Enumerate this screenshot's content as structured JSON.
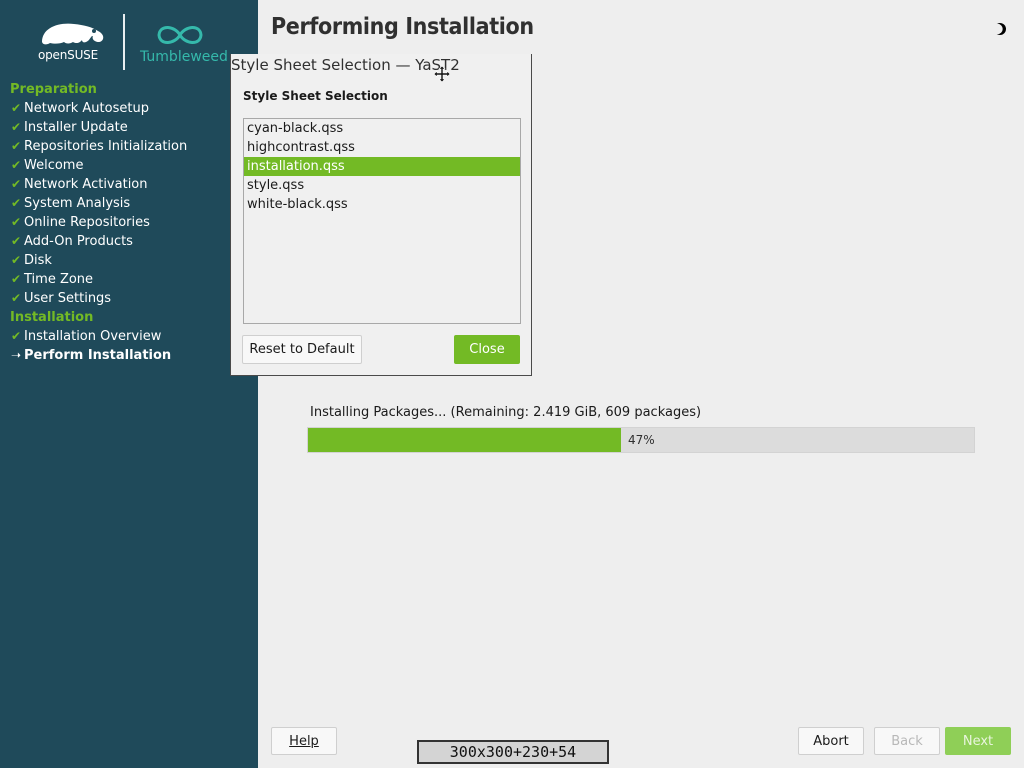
{
  "sidebar": {
    "logo_brand": "openSUSE",
    "logo_product": "Tumbleweed",
    "sections": [
      {
        "title": "Preparation",
        "items": [
          {
            "label": "Network Autosetup"
          },
          {
            "label": "Installer Update"
          },
          {
            "label": "Repositories Initialization"
          },
          {
            "label": "Welcome"
          },
          {
            "label": "Network Activation"
          },
          {
            "label": "System Analysis"
          },
          {
            "label": "Online Repositories"
          },
          {
            "label": "Add-On Products"
          },
          {
            "label": "Disk"
          },
          {
            "label": "Time Zone"
          },
          {
            "label": "User Settings"
          }
        ]
      },
      {
        "title": "Installation",
        "items": [
          {
            "label": "Installation Overview"
          },
          {
            "label": "Perform Installation"
          }
        ]
      }
    ]
  },
  "main": {
    "title": "Performing Installation",
    "progress": {
      "label": "Installing Packages... (Remaining: 2.419 GiB, 609 packages)",
      "text": "47%",
      "value": 0.47
    }
  },
  "buttons": {
    "help": "Help",
    "abort": "Abort",
    "back": "Back",
    "next": "Next"
  },
  "dialog": {
    "window_title": "Style Sheet Selection — YaST2",
    "heading": "Style Sheet Selection",
    "items": [
      {
        "label": "cyan-black.qss"
      },
      {
        "label": "highcontrast.qss"
      },
      {
        "label": "installation.qss",
        "selected": true
      },
      {
        "label": "style.qss"
      },
      {
        "label": "white-black.qss"
      }
    ],
    "reset_label": "Reset to Default",
    "close_label": "Close"
  },
  "geometry_tooltip": "300x300+230+54",
  "colors": {
    "sidebar_bg": "#1f4a5a",
    "accent_green": "#73ba25",
    "tumbleweed_teal": "#35b9ab",
    "page_bg": "#eeeeee"
  },
  "icons": {
    "step_done": "check-icon",
    "step_current": "arrow-right-icon",
    "theme_toggle": "half-moon-icon",
    "cursor": "move-cursor-icon"
  }
}
